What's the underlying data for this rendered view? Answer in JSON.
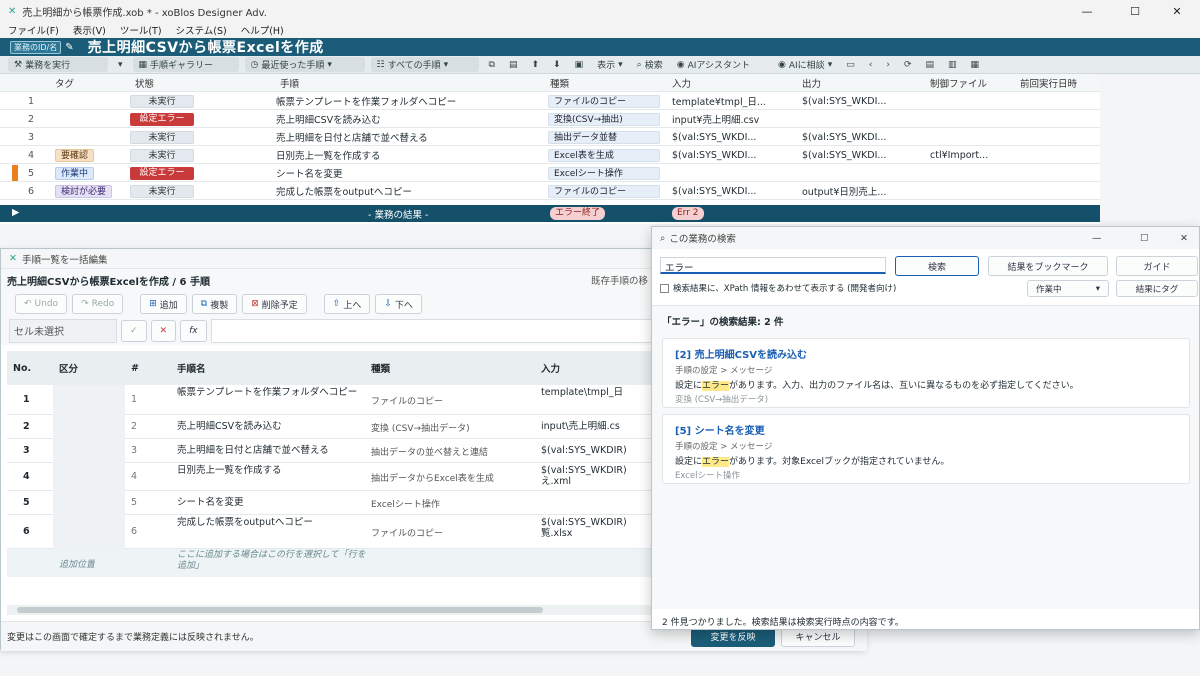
{
  "window": {
    "title": "売上明細から帳票作成.xob * - xoBlos Designer Adv.",
    "minimize_glyph": "—",
    "maximize_glyph": "☐",
    "close_glyph": "✕"
  },
  "menu": [
    "ファイル(F)",
    "表示(V)",
    "ツール(T)",
    "システム(S)",
    "ヘルプ(H)"
  ],
  "header": {
    "tag": "業務のID/名",
    "title": "売上明細CSVから帳票Excelを作成"
  },
  "toolbar": {
    "run": "業務を実行",
    "gallery": "手順ギャラリー",
    "recent": "最近使った手順",
    "all_steps": "すべての手順",
    "display": "表示",
    "search": "検索",
    "ai_assistant": "AIアシスタント",
    "ai_consult": "AIに相談"
  },
  "grid": {
    "headers": [
      "タグ",
      "状態",
      "手順",
      "種類",
      "入力",
      "出力",
      "制御ファイル",
      "前回実行日時"
    ],
    "rows": [
      {
        "no": "1",
        "tag": "",
        "status": "未実行",
        "status_kind": "gray",
        "step": "帳票テンプレートを作業フォルダへコピー",
        "type": "ファイルのコピー",
        "input": "template¥tmpl_日...",
        "output": "$(val:SYS_WKDI...",
        "ctrl": ""
      },
      {
        "no": "2",
        "tag": "",
        "status": "設定エラー",
        "status_kind": "red",
        "step": "売上明細CSVを読み込む",
        "type": "変換(CSV→抽出)",
        "input": "input¥売上明細.csv",
        "output": "",
        "ctrl": ""
      },
      {
        "no": "3",
        "tag": "",
        "status": "未実行",
        "status_kind": "gray",
        "step": "売上明細を日付と店舗で並べ替える",
        "type": "抽出データ並替",
        "input": "$(val:SYS_WKDI...",
        "output": "$(val:SYS_WKDI...",
        "ctrl": ""
      },
      {
        "no": "4",
        "tag": "要確認",
        "tag_kind": "orange",
        "status": "未実行",
        "status_kind": "gray",
        "step": "日別売上一覧を作成する",
        "type": "Excel表を生成",
        "input": "$(val:SYS_WKDI...",
        "output": "$(val:SYS_WKDI...",
        "ctrl": "ctl¥Import..."
      },
      {
        "no": "5",
        "tag": "作業中",
        "tag_kind": "blue",
        "status": "設定エラー",
        "status_kind": "red",
        "step": "シート名を変更",
        "type": "Excelシート操作",
        "input": "",
        "output": "",
        "ctrl": ""
      },
      {
        "no": "6",
        "tag": "検討が必要",
        "tag_kind": "purple",
        "status": "未実行",
        "status_kind": "gray",
        "step": "完成した帳票をoutputへコピー",
        "type": "ファイルのコピー",
        "input": "$(val:SYS_WKDI...",
        "output": "output¥日別売上...",
        "ctrl": ""
      }
    ],
    "summary_label": "- 業務の結果 -",
    "summary_status": "エラー終了",
    "summary_err": "Err 2"
  },
  "editor": {
    "title": "手順一覧を一括編集",
    "subtitle": "売上明細CSVから帳票Excelを作成 / 6 手順",
    "right_note": "既存手順の移",
    "undo": "Undo",
    "redo": "Redo",
    "add": "追加",
    "copy": "複製",
    "delete": "削除予定",
    "up": "上へ",
    "down": "下へ",
    "cell_state": "セル未選択",
    "check_glyph": "✓",
    "cross_glyph": "✕",
    "fx_glyph": "fx",
    "headers": [
      "No.",
      "区分",
      "#",
      "手順名",
      "種類",
      "入力"
    ],
    "rows": [
      {
        "no": "1",
        "n": "1",
        "name": "帳票テンプレートを作業フォルダへコピー",
        "type": "ファイルのコピー",
        "input": "template\\tmpl_日",
        "bold": false
      },
      {
        "no": "2",
        "n": "2",
        "name": "売上明細CSVを読み込む",
        "type": "変換 (CSV→抽出データ)",
        "input": "input\\売上明細.cs",
        "bold": false
      },
      {
        "no": "3",
        "n": "3",
        "name": "売上明細を日付と店舗で並べ替える",
        "type": "抽出データの並べ替えと連結",
        "input": "$(val:SYS_WKDIR)",
        "bold": true
      },
      {
        "no": "4",
        "n": "4",
        "name": "日別売上一覧を作成する",
        "type": "抽出データからExcel表を生成",
        "input": "$(val:SYS_WKDIR)\nえ.xml",
        "bold": true
      },
      {
        "no": "5",
        "n": "5",
        "name": "シート名を変更",
        "type": "Excelシート操作",
        "input": "",
        "bold": false
      },
      {
        "no": "6",
        "n": "6",
        "name": "完成した帳票をoutputへコピー",
        "type": "ファイルのコピー",
        "input": "$(val:SYS_WKDIR)\n覧.xlsx",
        "bold": true
      }
    ],
    "add_pos": "追加位置",
    "add_hint": "ここに追加する場合はこの行を選択して「行を追加」",
    "footer_note": "変更はこの画面で確定するまで業務定義には反映されません。",
    "apply": "変更を反映",
    "cancel": "キャンセル"
  },
  "search": {
    "title": "この業務の検索",
    "query": "エラー",
    "search_btn": "検索",
    "bookmark_btn": "結果をブックマーク",
    "guide_btn": "ガイド",
    "xpath_label": "検索結果に、XPath 情報をあわせて表示する (開発者向け)",
    "tag_select": "作業中",
    "tag_btn": "結果にタグ",
    "result_head": "「エラー」の検索結果: 2 件",
    "results": [
      {
        "title": "[2] 売上明細CSVを読み込む",
        "path": "手順の設定 > メッセージ",
        "pre": "設定に",
        "hit": "エラー",
        "post": "があります。入力、出力のファイル名は、互いに異なるものを必ず指定してください。",
        "kind": "変換 (CSV→抽出データ)"
      },
      {
        "title": "[5] シート名を変更",
        "path": "手順の設定 > メッセージ",
        "pre": "設定に",
        "hit": "エラー",
        "post": "があります。対象Excelブックが指定されていません。",
        "kind": "Excelシート操作"
      }
    ],
    "footer": "2 件見つかりました。検索結果は検索実行時点の内容です。"
  },
  "colors": {
    "header": "#1b5d78",
    "summary": "#14506a",
    "error": "#c93a3a",
    "link": "#1a5fb4"
  }
}
